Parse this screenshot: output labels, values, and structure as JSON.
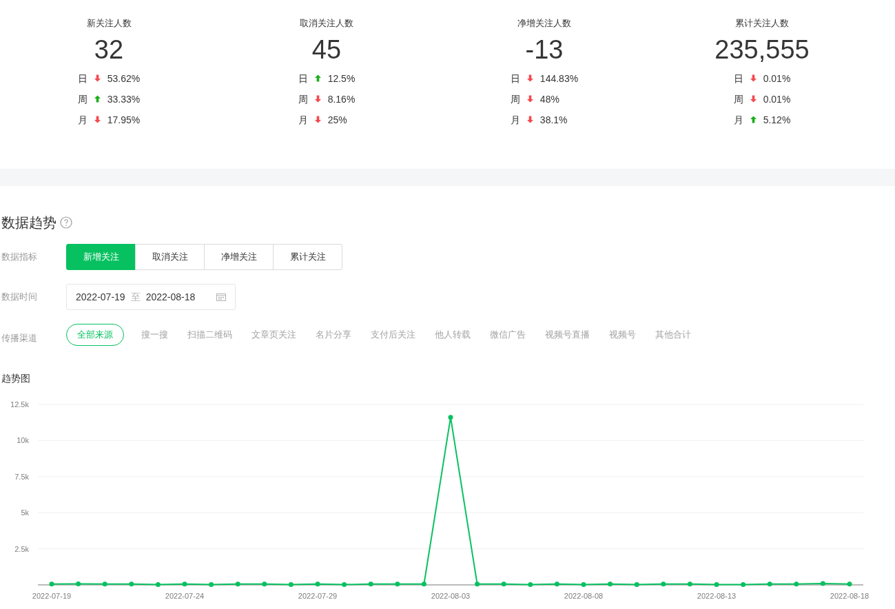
{
  "stats": [
    {
      "title": "新关注人数",
      "value": "32",
      "changes": [
        {
          "period": "日",
          "increase": false,
          "percent": "53.62%"
        },
        {
          "period": "周",
          "increase": true,
          "percent": "33.33%"
        },
        {
          "period": "月",
          "increase": false,
          "percent": "17.95%"
        }
      ]
    },
    {
      "title": "取消关注人数",
      "value": "45",
      "changes": [
        {
          "period": "日",
          "increase": true,
          "percent": "12.5%"
        },
        {
          "period": "周",
          "increase": false,
          "percent": "8.16%"
        },
        {
          "period": "月",
          "increase": false,
          "percent": "25%"
        }
      ]
    },
    {
      "title": "净增关注人数",
      "value": "-13",
      "changes": [
        {
          "period": "日",
          "increase": false,
          "percent": "144.83%"
        },
        {
          "period": "周",
          "increase": false,
          "percent": "48%"
        },
        {
          "period": "月",
          "increase": false,
          "percent": "38.1%"
        }
      ]
    },
    {
      "title": "累计关注人数",
      "value": "235,555",
      "changes": [
        {
          "period": "日",
          "increase": false,
          "percent": "0.01%"
        },
        {
          "period": "周",
          "increase": false,
          "percent": "0.01%"
        },
        {
          "period": "月",
          "increase": true,
          "percent": "5.12%"
        }
      ]
    }
  ],
  "trend": {
    "title": "数据趋势",
    "metric": {
      "label": "数据指标",
      "options": [
        {
          "label": "新增关注",
          "selected": true
        },
        {
          "label": "取消关注",
          "selected": false
        },
        {
          "label": "净增关注",
          "selected": false
        },
        {
          "label": "累计关注",
          "selected": false
        }
      ]
    },
    "date": {
      "label": "数据时间",
      "start": "2022-07-19",
      "separator": "至",
      "end": "2022-08-18"
    },
    "channel": {
      "label": "传播渠道",
      "options": [
        {
          "label": "全部来源",
          "selected": true
        },
        {
          "label": "搜一搜",
          "selected": false
        },
        {
          "label": "扫描二维码",
          "selected": false
        },
        {
          "label": "文章页关注",
          "selected": false
        },
        {
          "label": "名片分享",
          "selected": false
        },
        {
          "label": "支付后关注",
          "selected": false
        },
        {
          "label": "他人转载",
          "selected": false
        },
        {
          "label": "微信广告",
          "selected": false
        },
        {
          "label": "视频号直播",
          "selected": false
        },
        {
          "label": "视频号",
          "selected": false
        },
        {
          "label": "其他合计",
          "selected": false
        }
      ]
    },
    "chart_title": "趋势图",
    "chart_data": {
      "type": "line",
      "categories": [
        "2022-07-19",
        null,
        null,
        null,
        null,
        "2022-07-24",
        null,
        null,
        null,
        null,
        "2022-07-29",
        null,
        null,
        null,
        null,
        "2022-08-03",
        null,
        null,
        null,
        null,
        "2022-08-08",
        null,
        null,
        null,
        null,
        "2022-08-13",
        null,
        null,
        null,
        null,
        "2022-08-18"
      ],
      "series": [
        {
          "color": "#07c160",
          "marker": true,
          "values": [
            60,
            70,
            60,
            60,
            20,
            60,
            20,
            60,
            60,
            20,
            60,
            20,
            60,
            60,
            60,
            11600,
            60,
            60,
            20,
            60,
            20,
            60,
            20,
            60,
            60,
            20,
            20,
            60,
            60,
            90,
            60
          ]
        }
      ],
      "grid": true,
      "ylim": [
        0,
        12500
      ],
      "yticks": [
        {
          "value": 2500,
          "label": "2.5k"
        },
        {
          "value": 5000,
          "label": "5k"
        },
        {
          "value": 7500,
          "label": "7.5k"
        },
        {
          "value": 10000,
          "label": "10k"
        },
        {
          "value": 12500,
          "label": "12.5k"
        }
      ]
    }
  }
}
